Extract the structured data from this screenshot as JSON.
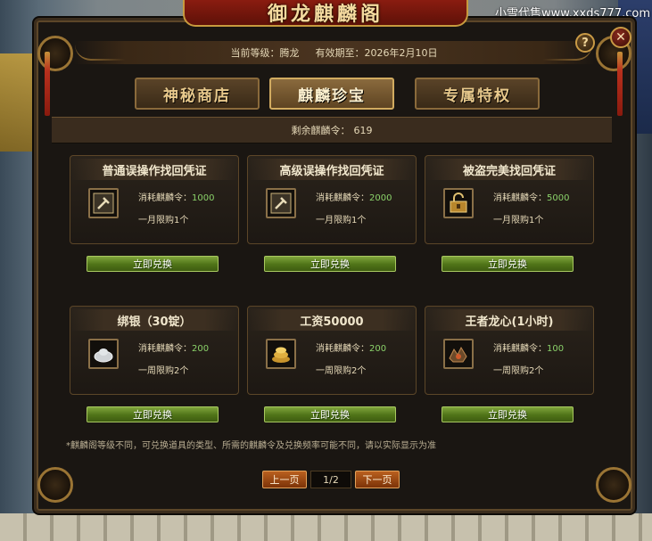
{
  "watermark": "小雪代售www.xxds777.com",
  "title": "御龙麒麟阁",
  "header": {
    "level_label": "当前等级：",
    "level_value": "腾龙",
    "expiry_label": "有效期至：",
    "expiry_value": "2026年2月10日"
  },
  "help_label": "?",
  "close_label": "✕",
  "tabs": [
    {
      "label": "神秘商店",
      "active": false
    },
    {
      "label": "麒麟珍宝",
      "active": true
    },
    {
      "label": "专属特权",
      "active": false
    }
  ],
  "balance": {
    "label": "剩余麒麟令：",
    "value": "619"
  },
  "cost_label": "消耗麒麟令：",
  "redeem_label": "立即兑换",
  "items": [
    {
      "title": "普通误操作找回凭证",
      "cost": "1000",
      "limit": "一月限购1个",
      "icon": "hammer-scroll-icon"
    },
    {
      "title": "高级误操作找回凭证",
      "cost": "2000",
      "limit": "一月限购1个",
      "icon": "hammer-scroll-icon"
    },
    {
      "title": "被盗完美找回凭证",
      "cost": "5000",
      "limit": "一月限购1个",
      "icon": "lock-chest-icon"
    },
    {
      "title": "绑银（30锭）",
      "cost": "200",
      "limit": "一周限购2个",
      "icon": "silver-ingot-icon"
    },
    {
      "title": "工资50000",
      "cost": "200",
      "limit": "一周限购2个",
      "icon": "gold-coins-icon"
    },
    {
      "title": "王者龙心(1小时)",
      "cost": "100",
      "limit": "一周限购2个",
      "icon": "dragon-heart-icon"
    }
  ],
  "note": "*麒麟阁等级不同，可兑换道具的类型、所需的麒麟令及兑换频率可能不同，请以实际显示为准",
  "pagination": {
    "prev": "上一页",
    "page": "1/2",
    "next": "下一页"
  },
  "colors": {
    "accent_gold": "#d1ab60",
    "cost_green": "#8bd26a",
    "redeem_green": "#5f8a1f",
    "page_orange": "#9c4a14"
  }
}
